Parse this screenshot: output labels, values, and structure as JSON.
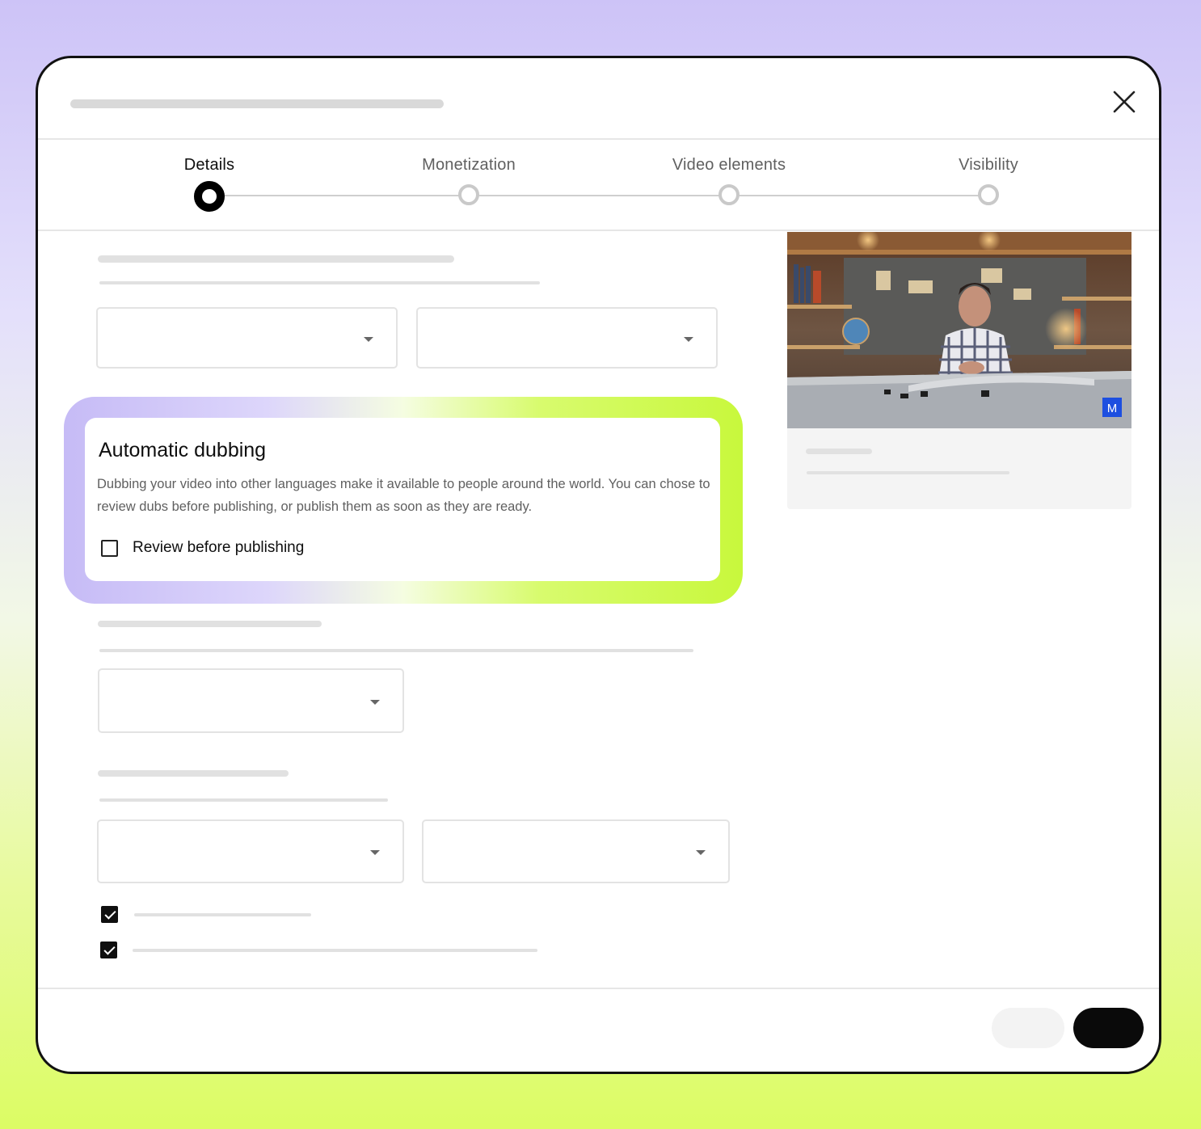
{
  "steps": [
    {
      "label": "Details",
      "active": true
    },
    {
      "label": "Monetization",
      "active": false
    },
    {
      "label": "Video elements",
      "active": false
    },
    {
      "label": "Visibility",
      "active": false
    }
  ],
  "dubbing": {
    "title": "Automatic dubbing",
    "description": "Dubbing your video into other languages make it available to people around the world. You can chose to review dubs before publishing, or publish them as soon as they are ready.",
    "review_label": "Review before publishing",
    "review_checked": false
  },
  "video_preview": {
    "badge": "M"
  },
  "icons": {
    "close": "close-icon",
    "dropdown": "chevron-down-icon"
  },
  "colors": {
    "active_step": "#000000",
    "inactive_step": "#c9c9c9",
    "glow_start": "#c6bbf6",
    "glow_end": "#c8f83c",
    "primary_button": "#0a0a0a"
  }
}
